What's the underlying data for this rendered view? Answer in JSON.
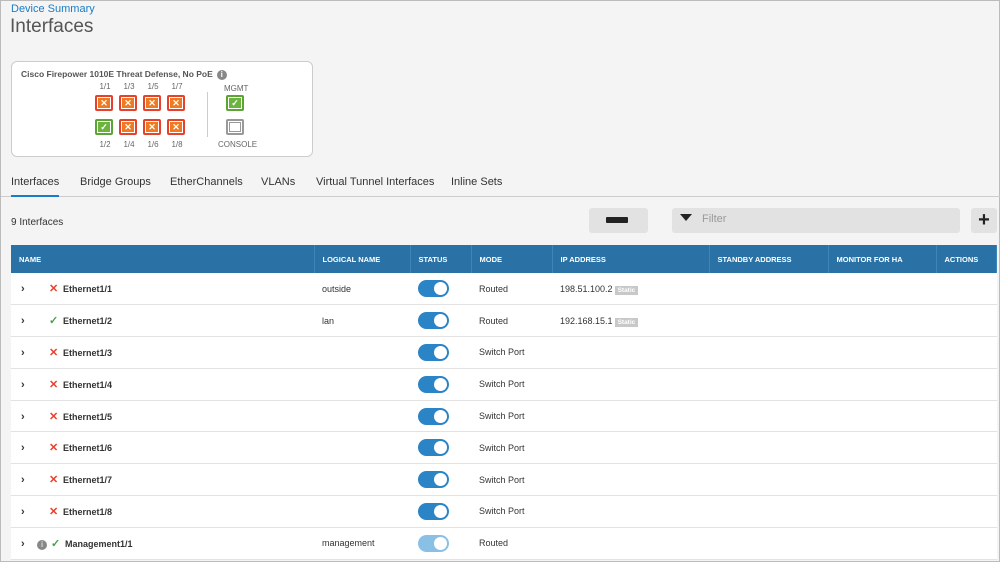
{
  "breadcrumb": "Device Summary",
  "title": "Interfaces",
  "device": {
    "name": "Cisco Firepower 1010E Threat Defense, No PoE",
    "top_ports": [
      {
        "label": "1/1",
        "status": "down"
      },
      {
        "label": "1/3",
        "status": "down"
      },
      {
        "label": "1/5",
        "status": "down"
      },
      {
        "label": "1/7",
        "status": "down"
      }
    ],
    "bottom_ports": [
      {
        "label": "1/2",
        "status": "up"
      },
      {
        "label": "1/4",
        "status": "down"
      },
      {
        "label": "1/6",
        "status": "down"
      },
      {
        "label": "1/8",
        "status": "down"
      }
    ],
    "mgmt_label": "MGMT",
    "console_label": "CONSOLE"
  },
  "tabs": [
    "Interfaces",
    "Bridge Groups",
    "EtherChannels",
    "VLANs",
    "Virtual Tunnel Interfaces",
    "Inline Sets"
  ],
  "count_label": "9 Interfaces",
  "filter_placeholder": "Filter",
  "add_label": "+",
  "columns": [
    "NAME",
    "LOGICAL NAME",
    "STATUS",
    "MODE",
    "IP ADDRESS",
    "STANDBY ADDRESS",
    "MONITOR FOR HA",
    "ACTIONS"
  ],
  "rows": [
    {
      "name": "Ethernet1/1",
      "ok": false,
      "logical": "outside",
      "mode": "Routed",
      "ip": "198.51.100.2",
      "ip_type": "Static"
    },
    {
      "name": "Ethernet1/2",
      "ok": true,
      "logical": "lan",
      "mode": "Routed",
      "ip": "192.168.15.1",
      "ip_type": "Static"
    },
    {
      "name": "Ethernet1/3",
      "ok": false,
      "logical": "",
      "mode": "Switch Port",
      "ip": "",
      "ip_type": ""
    },
    {
      "name": "Ethernet1/4",
      "ok": false,
      "logical": "",
      "mode": "Switch Port",
      "ip": "",
      "ip_type": ""
    },
    {
      "name": "Ethernet1/5",
      "ok": false,
      "logical": "",
      "mode": "Switch Port",
      "ip": "",
      "ip_type": ""
    },
    {
      "name": "Ethernet1/6",
      "ok": false,
      "logical": "",
      "mode": "Switch Port",
      "ip": "",
      "ip_type": ""
    },
    {
      "name": "Ethernet1/7",
      "ok": false,
      "logical": "",
      "mode": "Switch Port",
      "ip": "",
      "ip_type": ""
    },
    {
      "name": "Ethernet1/8",
      "ok": false,
      "logical": "",
      "mode": "Switch Port",
      "ip": "",
      "ip_type": ""
    },
    {
      "name": "Management1/1",
      "ok": true,
      "logical": "management",
      "mode": "Routed",
      "ip": "",
      "ip_type": "",
      "info": true
    }
  ]
}
